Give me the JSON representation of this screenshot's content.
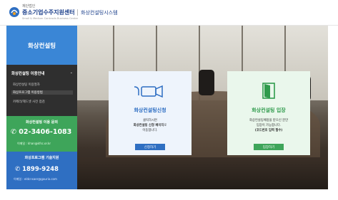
{
  "header": {
    "org_small": "재단법인",
    "org_name": "중소기업수주지원센터",
    "org_sub": "Small & Medium Contracts Business Center",
    "app_name": "화상컨설팅시스템"
  },
  "sidebar": {
    "title": "화상컨설팅",
    "section_title": "화상컨설팅 이용안내",
    "items": [
      {
        "label": "화상컨설팅 이용절차",
        "active": false
      },
      {
        "label": "화상프로그램 이용방법",
        "active": true
      },
      {
        "label": "카메라/헤드셋 사전 점검",
        "active": false
      }
    ],
    "contact": {
      "title": "화상컨설팅 이용 문의",
      "phone": "02-3406-1083",
      "email": "이메일 : khan@kfsc.or.kr"
    },
    "tech": {
      "title": "화상프로그램 기술지원",
      "phone": "1899-9248",
      "email": "이메일 : eldcnsaer@gaurio.com"
    }
  },
  "cards": {
    "apply": {
      "icon": "camera-icon",
      "title": "화상컨설팅신청",
      "desc_line1": "클릭하시면",
      "desc_line2_bold": "화상컨설팅 신청 페이지",
      "desc_line2_rest": "로",
      "desc_line3": "이동합니다.",
      "button": "신청하기"
    },
    "enter": {
      "icon": "door-enter-icon",
      "title": "화상컨설팅 입장",
      "desc_line1": "화상컨설팅예정을 받으신 분만",
      "desc_line2": "입장이 가능합니다.",
      "desc_line3": "(코드번호 입력 필수)",
      "button": "입장하기"
    }
  },
  "colors": {
    "primary_blue": "#2f6fc2",
    "sidebar_title_blue": "#3a86d6",
    "primary_green": "#3ea55a",
    "sidebar_dark": "#2b2b2b"
  }
}
